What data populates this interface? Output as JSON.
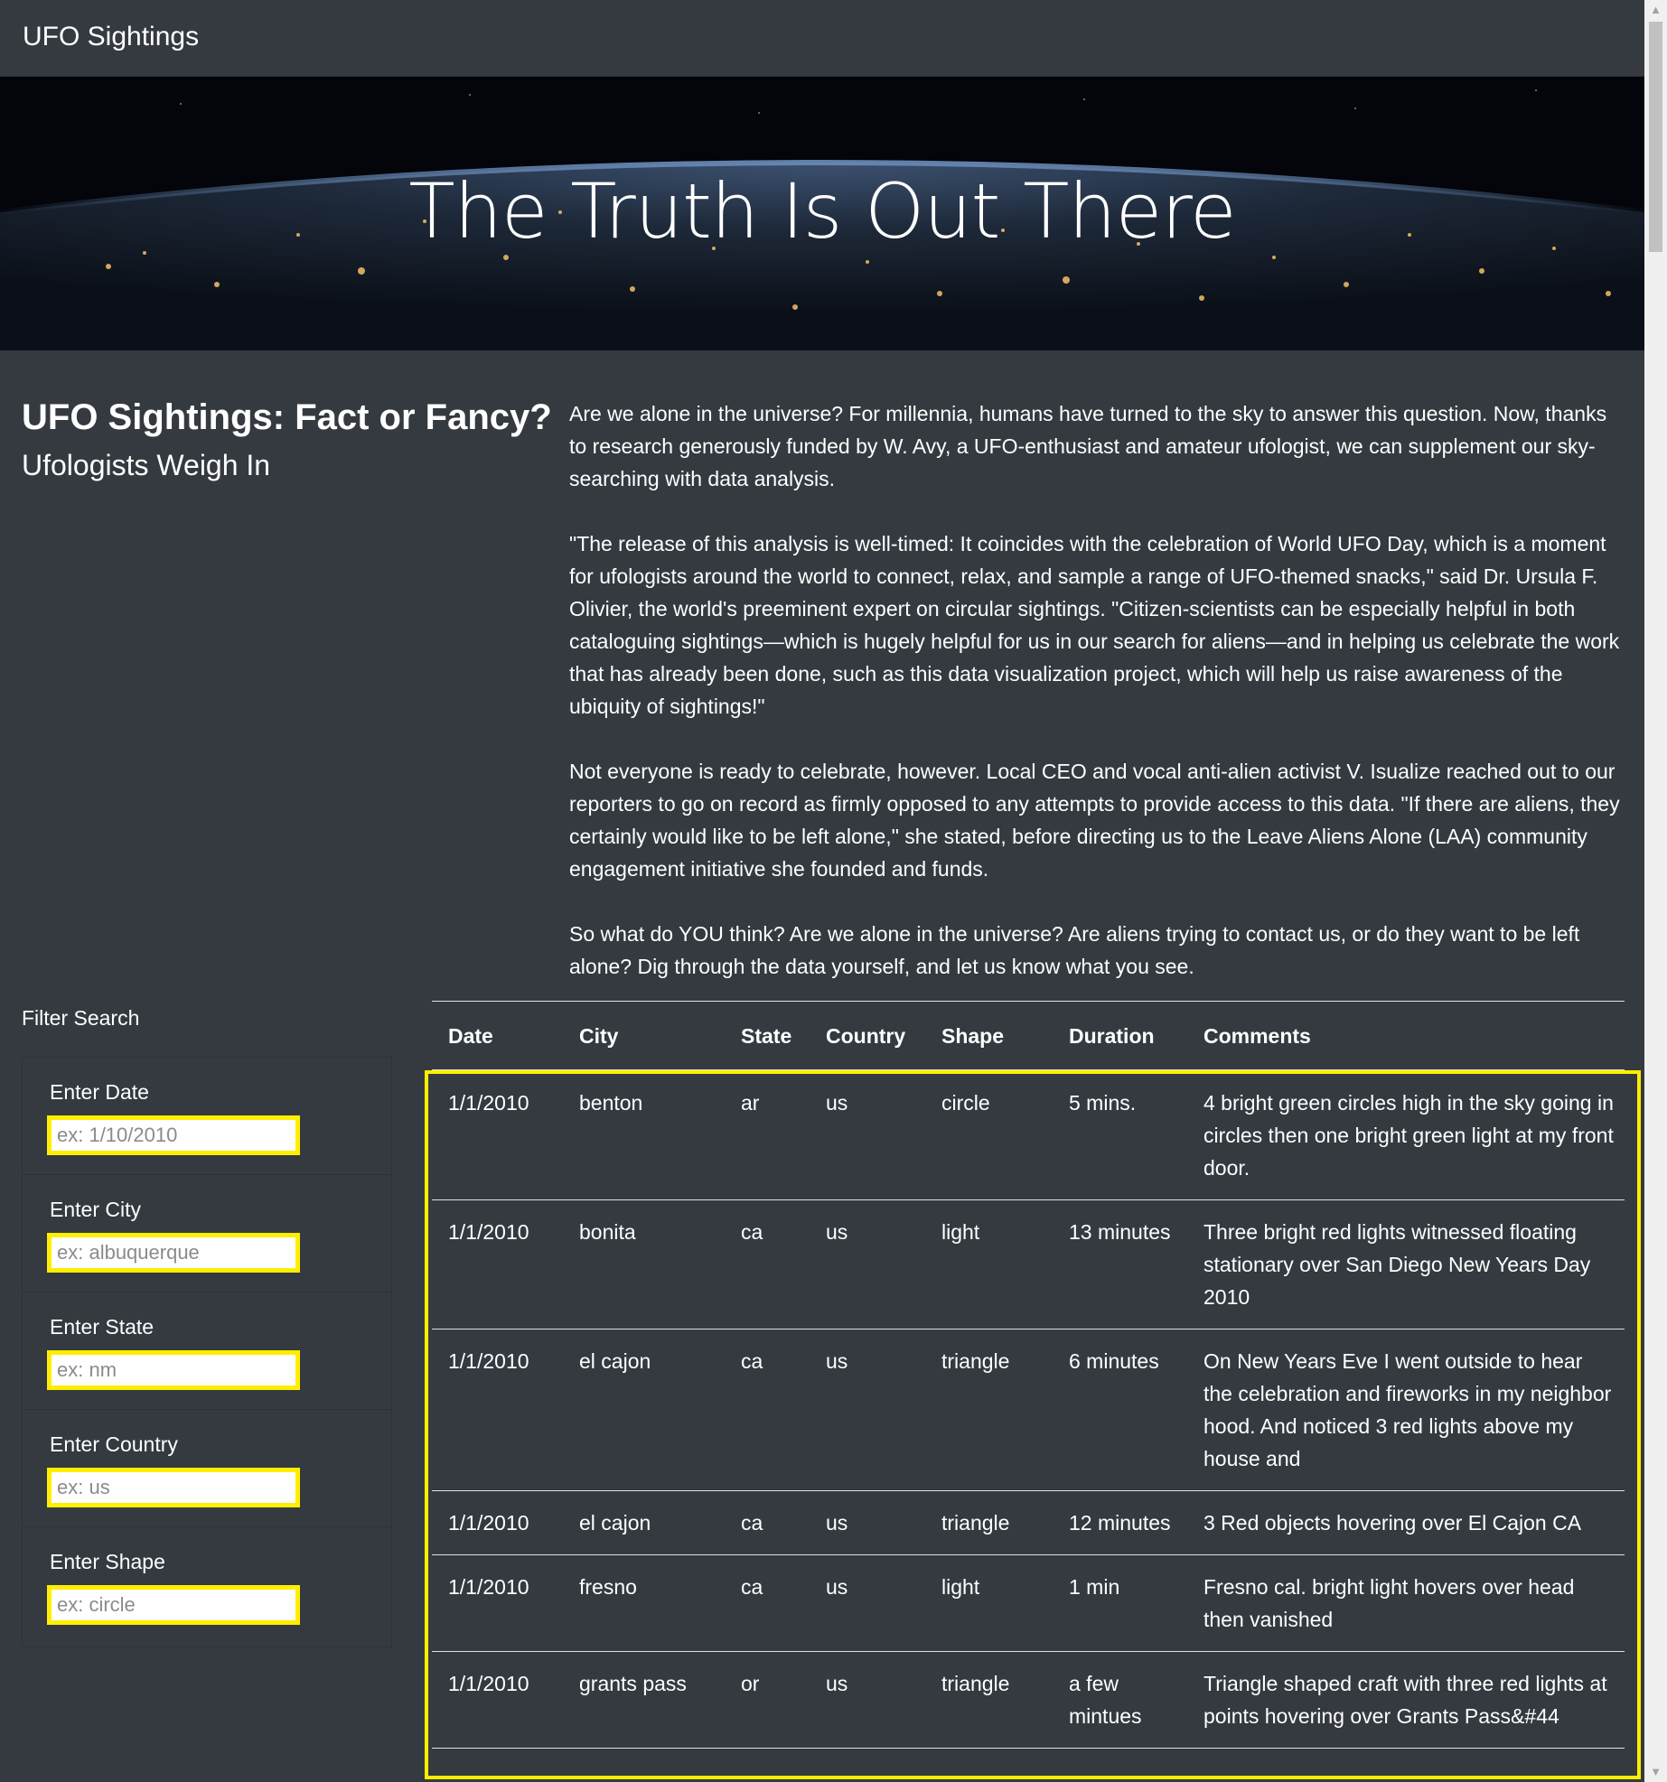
{
  "nav": {
    "brand": "UFO Sightings"
  },
  "hero": {
    "title": "The Truth Is Out There"
  },
  "intro": {
    "title": "UFO Sightings: Fact or Fancy?",
    "subtitle": "Ufologists Weigh In",
    "paragraphs": [
      "Are we alone in the universe? For millennia, humans have turned to the sky to answer this question. Now, thanks to research generously funded by W. Avy, a UFO-enthusiast and amateur ufologist, we can supplement our sky-searching with data analysis.",
      "\"The release of this analysis is well-timed: It coincides with the celebration of World UFO Day, which is a moment for ufologists around the world to connect, relax, and sample a range of UFO-themed snacks,\" said Dr. Ursula F. Olivier, the world's preeminent expert on circular sightings. \"Citizen-scientists can be especially helpful in both cataloguing sightings—which is hugely helpful for us in our search for aliens—and in helping us celebrate the work that has already been done, such as this data visualization project, which will help us raise awareness of the ubiquity of sightings!\"",
      "Not everyone is ready to celebrate, however. Local CEO and vocal anti-alien activist V. Isualize reached out to our reporters to go on record as firmly opposed to any attempts to provide access to this data. \"If there are aliens, they certainly would like to be left alone,\" she stated, before directing us to the Leave Aliens Alone (LAA) community engagement initiative she founded and funds.",
      "So what do YOU think? Are we alone in the universe? Are aliens trying to contact us, or do they want to be left alone? Dig through the data yourself, and let us know what you see."
    ]
  },
  "filters": {
    "title": "Filter Search",
    "items": [
      {
        "label": "Enter Date",
        "placeholder": "ex: 1/10/2010",
        "value": ""
      },
      {
        "label": "Enter City",
        "placeholder": "ex: albuquerque",
        "value": ""
      },
      {
        "label": "Enter State",
        "placeholder": "ex: nm",
        "value": ""
      },
      {
        "label": "Enter Country",
        "placeholder": "ex: us",
        "value": ""
      },
      {
        "label": "Enter Shape",
        "placeholder": "ex: circle",
        "value": ""
      }
    ]
  },
  "table": {
    "headers": [
      "Date",
      "City",
      "State",
      "Country",
      "Shape",
      "Duration",
      "Comments"
    ],
    "rows": [
      [
        "1/1/2010",
        "benton",
        "ar",
        "us",
        "circle",
        "5 mins.",
        "4 bright green circles high in the sky going in circles then one bright green light at my front door."
      ],
      [
        "1/1/2010",
        "bonita",
        "ca",
        "us",
        "light",
        "13 minutes",
        "Three bright red lights witnessed floating stationary over San Diego New Years Day 2010"
      ],
      [
        "1/1/2010",
        "el cajon",
        "ca",
        "us",
        "triangle",
        "6 minutes",
        "On New Years Eve I went outside to hear the celebration and fireworks in my neighbor hood. And noticed 3 red lights above my house and"
      ],
      [
        "1/1/2010",
        "el cajon",
        "ca",
        "us",
        "triangle",
        "12 minutes",
        "3 Red objects hovering over El Cajon CA"
      ],
      [
        "1/1/2010",
        "fresno",
        "ca",
        "us",
        "light",
        "1 min",
        "Fresno cal. bright light hovers over head then vanished"
      ],
      [
        "1/1/2010",
        "grants pass",
        "or",
        "us",
        "triangle",
        "a few mintues",
        "Triangle shaped craft with three red lights at points hovering over Grants Pass&#44"
      ]
    ]
  },
  "colors": {
    "background": "#343a40",
    "highlight": "#ffee00",
    "text": "#ffffff"
  },
  "icons": {
    "scroll_up": "arrow-up-icon",
    "scroll_down": "arrow-down-icon"
  }
}
